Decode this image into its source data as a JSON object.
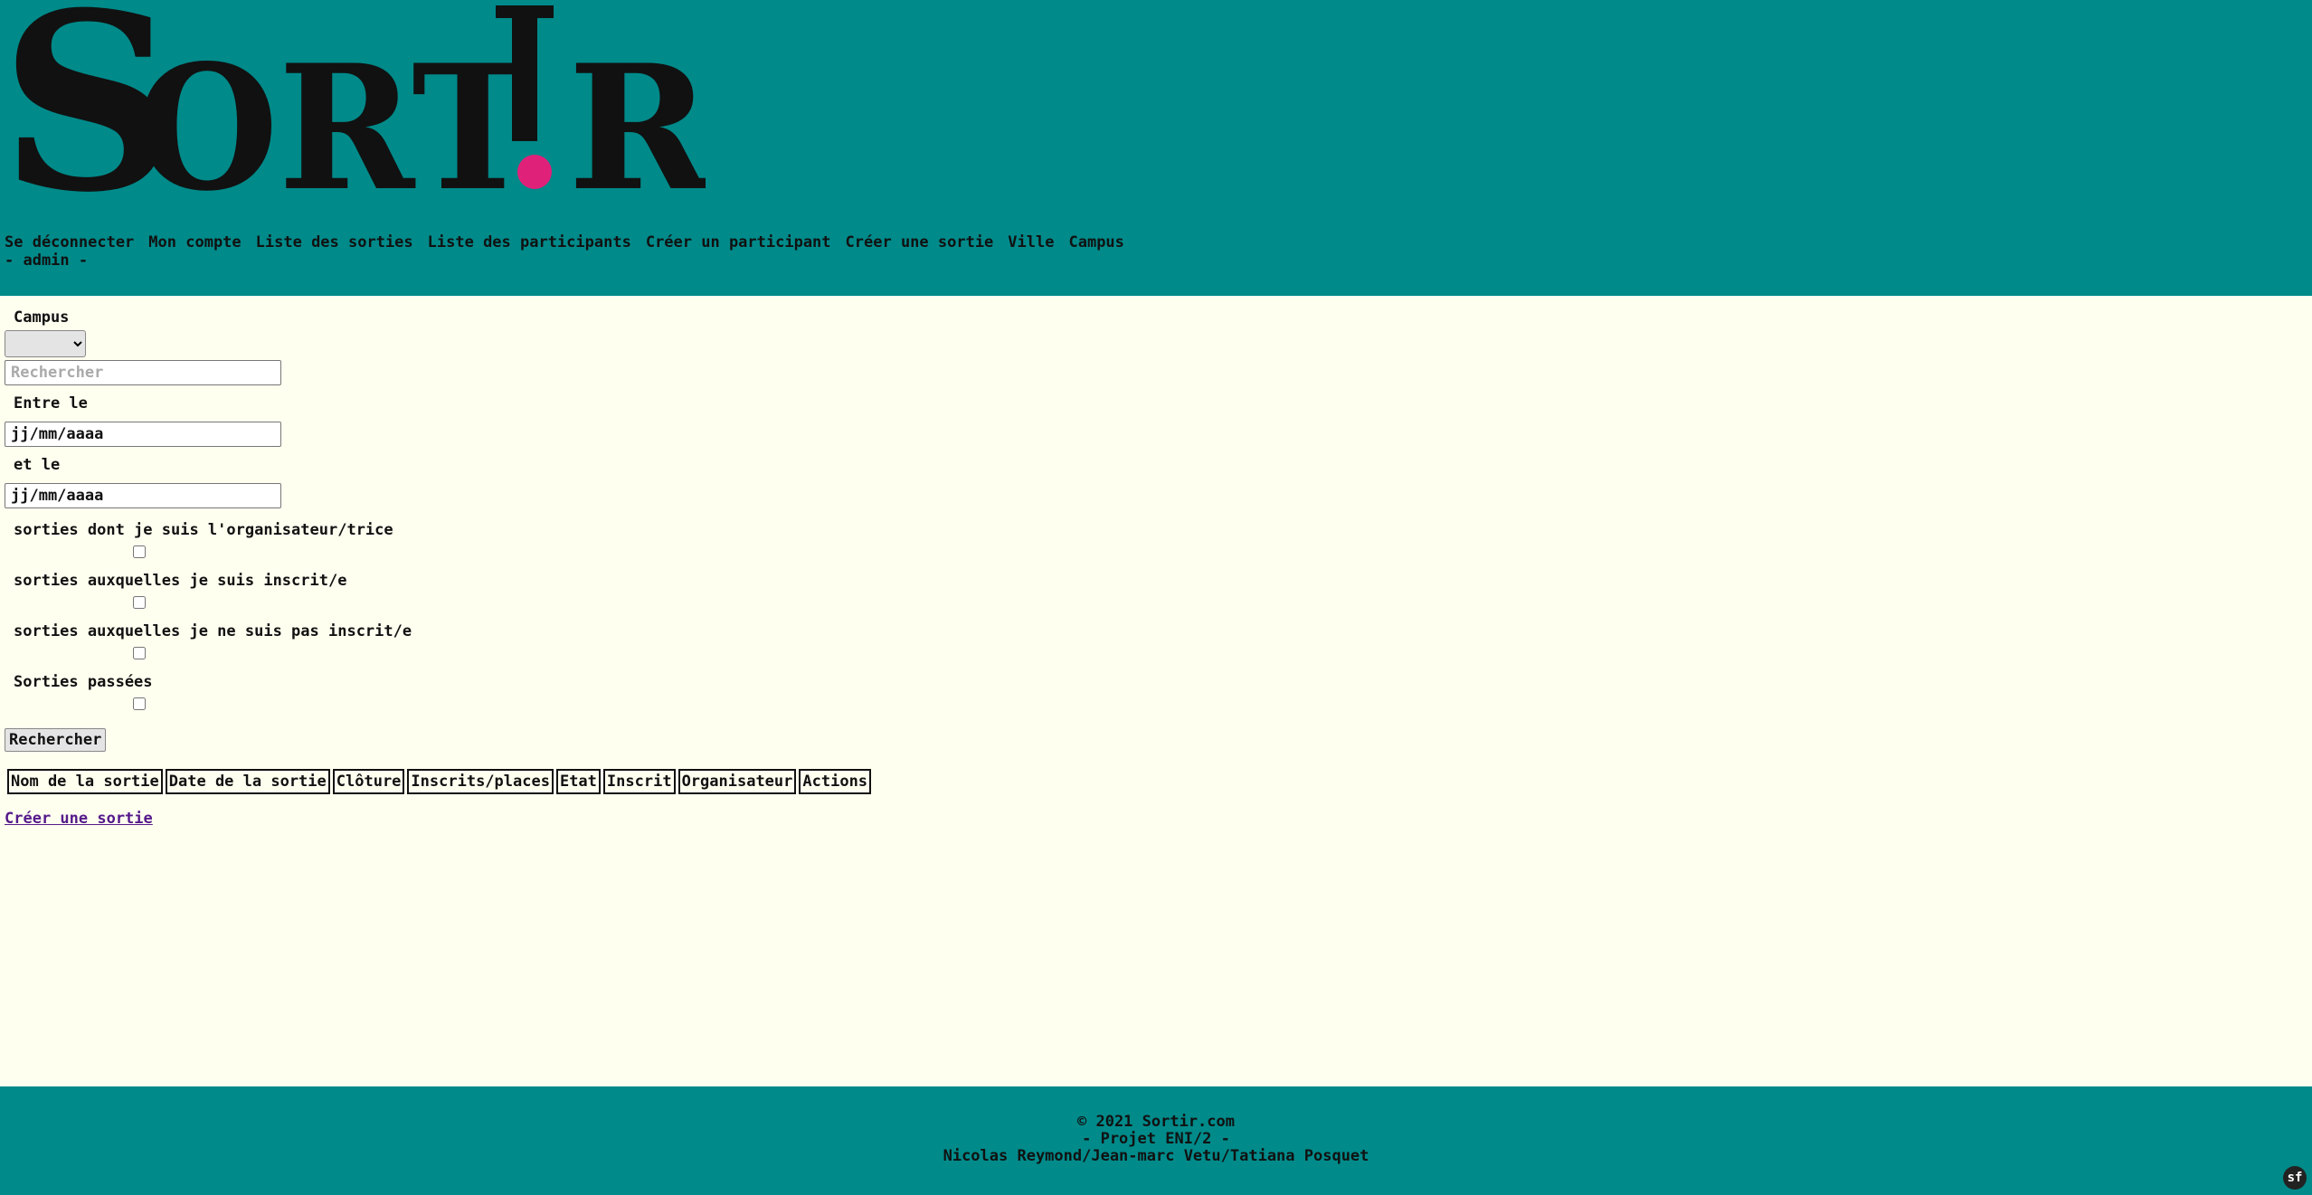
{
  "logo": {
    "text": "SORTIR"
  },
  "nav": {
    "links": [
      "Se déconnecter",
      "Mon compte",
      "Liste des sorties",
      "Liste des participants",
      "Créer un participant",
      "Créer une sortie",
      "Ville",
      "Campus"
    ],
    "user": "- admin -"
  },
  "filters": {
    "campus_label": "Campus",
    "campus_value": "",
    "search_placeholder": "Rechercher",
    "date_from_label": "Entre le",
    "date_from_value": "jj/mm/aaaa",
    "date_to_label": "et le",
    "date_to_value": "jj/mm/aaaa",
    "checks": [
      {
        "label": "sorties dont je suis l'organisateur/trice",
        "checked": false
      },
      {
        "label": "sorties auxquelles je suis inscrit/e",
        "checked": false
      },
      {
        "label": "sorties auxquelles je ne suis pas inscrit/e",
        "checked": false
      },
      {
        "label": "Sorties passées",
        "checked": false
      }
    ],
    "submit_label": "Rechercher"
  },
  "table": {
    "headers": [
      "Nom de la sortie",
      "Date de la sortie",
      "Clôture",
      "Inscrits/places",
      "Etat",
      "Inscrit",
      "Organisateur",
      "Actions"
    ]
  },
  "create_link": "Créer une sortie",
  "footer": {
    "line1": "© 2021 Sortir.com",
    "line2": "- Projet ENI/2 -",
    "line3": "Nicolas Reymond/Jean-marc Vetu/Tatiana Posquet"
  },
  "colors": {
    "header_bg": "#008a8a",
    "body_bg": "#fffff0",
    "logo_dot": "#e0217a"
  },
  "icons": {
    "corner": "symfony-icon"
  }
}
